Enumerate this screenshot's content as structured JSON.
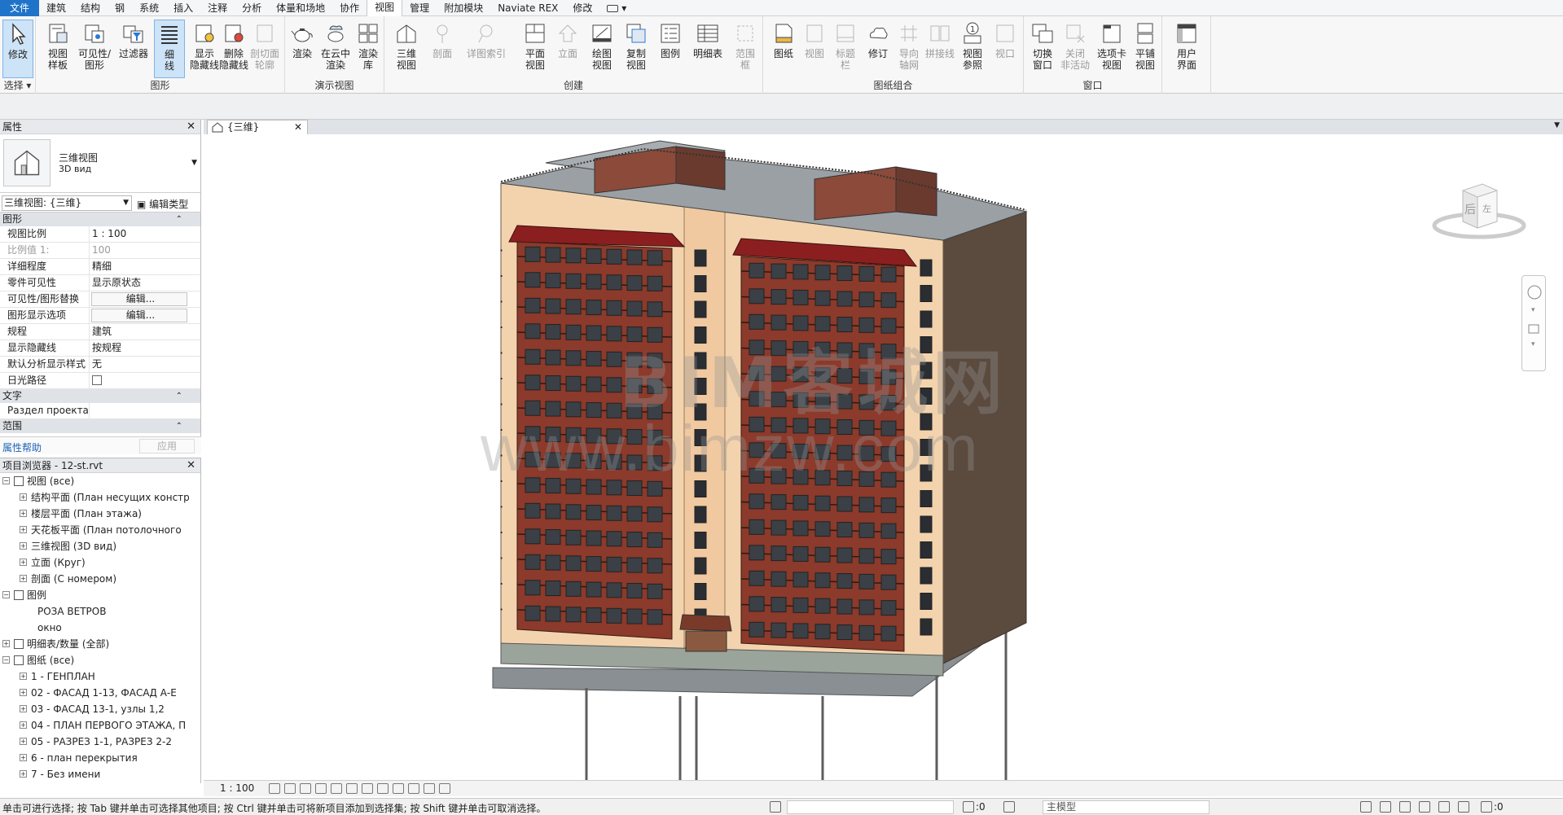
{
  "menu": {
    "tabs": [
      "文件",
      "建筑",
      "结构",
      "钢",
      "系统",
      "插入",
      "注释",
      "分析",
      "体量和场地",
      "协作",
      "视图",
      "管理",
      "附加模块",
      "Naviate REX",
      "修改"
    ],
    "active": "视图"
  },
  "ribbon": {
    "groups": {
      "select": "选择",
      "graphics": "图形",
      "presentation": "演示视图",
      "create": "创建",
      "sheet": "图纸组合",
      "window": "窗口"
    },
    "buttons": {
      "modify": "修改",
      "view_template": "视图\n样板",
      "visibility": "可见性/\n图形",
      "filters": "过滤器",
      "thin_lines": "细\n线",
      "show_hidden": "显示\n隐藏线",
      "remove_hidden": "删除\n隐藏线",
      "cut_profile": "剖切面\n轮廓",
      "render": "渲染",
      "render_cloud": "在云中\n渲染",
      "render_gallery": "渲染\n库",
      "view_3d": "三维\n视图",
      "section": "剖面",
      "callout": "详图索引",
      "plan_views": "平面\n视图",
      "elevation": "立面",
      "drafting_view": "绘图\n视图",
      "duplicate_view": "复制\n视图",
      "legends": "图例",
      "schedules": "明细表",
      "scope_box": "范围\n框",
      "sheet": "图纸",
      "view": "视图",
      "title_block": "标题\n栏",
      "revisions": "修订",
      "guide_grid": "导向\n轴网",
      "matchline": "拼接线",
      "view_reference": "视图\n参照",
      "viewports": "视口",
      "switch_windows": "切换\n窗口",
      "close_inactive": "关闭\n非活动",
      "tab_views": "选项卡\n视图",
      "tile_views": "平铺\n视图",
      "user_interface": "用户\n界面"
    }
  },
  "properties": {
    "title": "属性",
    "type_name_1": "三维视图",
    "type_name_2": "3D вид",
    "selector": "三维视图: {三维}",
    "edit_type": "编辑类型",
    "sections": {
      "graphics": "图形",
      "text": "文字",
      "range": "范围"
    },
    "rows": [
      {
        "k": "视图比例",
        "v": "1 : 100"
      },
      {
        "k": "比例值 1:",
        "v": "100"
      },
      {
        "k": "详细程度",
        "v": "精细"
      },
      {
        "k": "零件可见性",
        "v": "显示原状态"
      },
      {
        "k": "可见性/图形替换",
        "v": "编辑..."
      },
      {
        "k": "图形显示选项",
        "v": "编辑..."
      },
      {
        "k": "规程",
        "v": "建筑"
      },
      {
        "k": "显示隐藏线",
        "v": "按规程"
      },
      {
        "k": "默认分析显示样式",
        "v": "无"
      },
      {
        "k": "日光路径",
        "v": ""
      }
    ],
    "text_row": {
      "k": "Раздел проекта",
      "v": ""
    },
    "help": "属性帮助",
    "apply": "应用"
  },
  "browser": {
    "title": "项目浏览器 - 12-st.rvt",
    "items": [
      {
        "label": "视图 (все)",
        "level": 0,
        "expanded": true
      },
      {
        "label": "结构平面 (План несущих констр",
        "level": 1
      },
      {
        "label": "楼层平面 (План этажа)",
        "level": 1
      },
      {
        "label": "天花板平面 (План потолочного",
        "level": 1
      },
      {
        "label": "三维视图 (3D вид)",
        "level": 1
      },
      {
        "label": "立面 (Круг)",
        "level": 1
      },
      {
        "label": "剖面 (С номером)",
        "level": 1
      },
      {
        "label": "图例",
        "level": 0,
        "expanded": true
      },
      {
        "label": "РОЗА ВЕТРОВ",
        "level": 2
      },
      {
        "label": "окно",
        "level": 2
      },
      {
        "label": "明细表/数量 (全部)",
        "level": 0
      },
      {
        "label": "图纸 (все)",
        "level": 0,
        "expanded": true
      },
      {
        "label": "1 - ГЕНПЛАН",
        "level": 1
      },
      {
        "label": "02 - ФАСАД 1-13, ФАСАД А-Е",
        "level": 1
      },
      {
        "label": "03 - ФАСАД 13-1, узлы 1,2",
        "level": 1
      },
      {
        "label": "04 - ПЛАН ПЕРВОГО ЭТАЖА, П",
        "level": 1
      },
      {
        "label": "05 - РАЗРЕЗ 1-1, РАЗРЕЗ 2-2",
        "level": 1
      },
      {
        "label": "6 - план перекрытия",
        "level": 1
      },
      {
        "label": "7 - Без имени",
        "level": 1
      }
    ]
  },
  "view_tab": {
    "title": "{三维}"
  },
  "viewcube": {
    "face_back": "后",
    "face_left": "左"
  },
  "watermark": {
    "line1": "BIM客城网",
    "line2": "www.bimzw.com"
  },
  "view_control": {
    "scale": "1 : 100"
  },
  "status": {
    "message": "单击可进行选择; 按 Tab 键并单击可选择其他项目; 按 Ctrl 键并单击可将新项目添加到选择集; 按 Shift 键并单击可取消选择。",
    "count": ":0",
    "model": "主模型",
    "filter_count": ":0"
  },
  "colors": {
    "accent": "#1f74c9",
    "facade": "#f3d3ad",
    "brick": "#8b3a2b",
    "shade": "#5b4a3e",
    "roof": "#9aa0a4"
  }
}
